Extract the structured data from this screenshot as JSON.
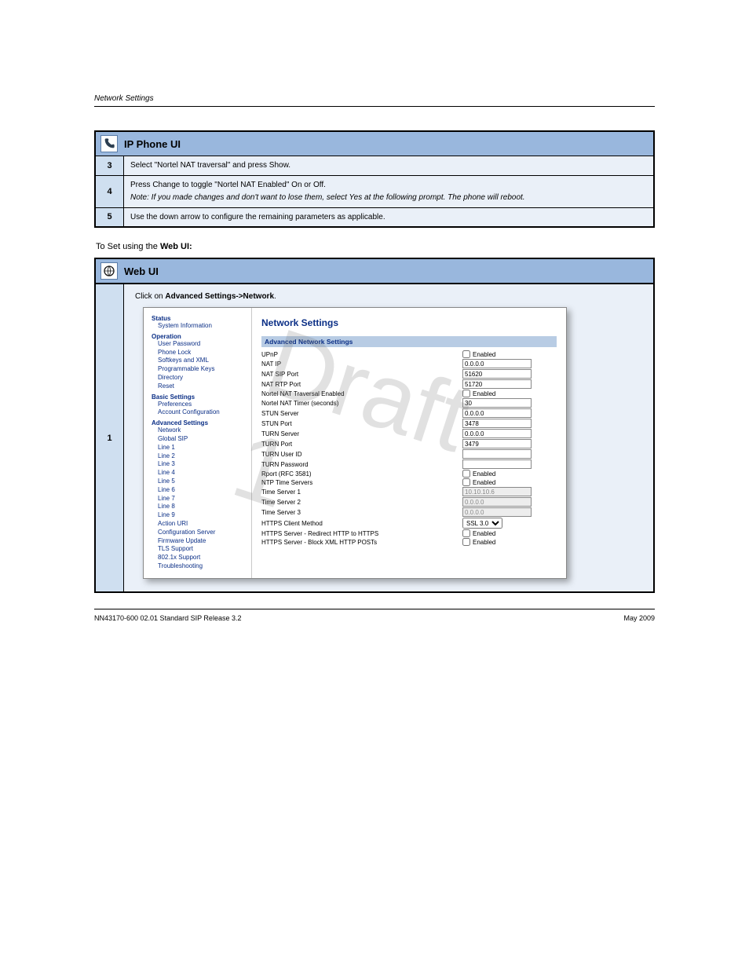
{
  "header": {
    "title": "Network Settings"
  },
  "phone_panel": {
    "title": "IP Phone UI",
    "steps": [
      {
        "num": "3",
        "text": "Select \"Nortel NAT traversal\" and press Show."
      },
      {
        "num": "4",
        "text": "Press Change to toggle \"Nortel NAT Enabled\" On or Off.",
        "note": "Note: If you made changes and don't want to lose them, select Yes at the following prompt. The phone will reboot."
      },
      {
        "num": "5",
        "text": "Use the down arrow to configure the remaining parameters as applicable."
      }
    ]
  },
  "section_label": {
    "prefix": "To Set using the ",
    "strong": "Web UI:"
  },
  "web_panel": {
    "title": "Web UI",
    "step1": {
      "num": "1",
      "text_prefix": "Click on ",
      "link": "Advanced Settings->Network",
      "text_suffix": "."
    }
  },
  "screenshot": {
    "sidebar": {
      "groups": [
        {
          "header": "Status",
          "items": [
            "System Information"
          ]
        },
        {
          "header": "Operation",
          "items": [
            "User Password",
            "Phone Lock",
            "Softkeys and XML",
            "Programmable Keys",
            "Directory",
            "Reset"
          ]
        },
        {
          "header": "Basic Settings",
          "items": [
            "Preferences",
            "Account Configuration"
          ]
        },
        {
          "header": "Advanced Settings",
          "items": [
            "Network",
            "Global SIP",
            "Line 1",
            "Line 2",
            "Line 3",
            "Line 4",
            "Line 5",
            "Line 6",
            "Line 7",
            "Line 8",
            "Line 9",
            "Action URI",
            "Configuration Server",
            "Firmware Update",
            "TLS Support",
            "802.1x Support",
            "Troubleshooting"
          ]
        }
      ]
    },
    "main": {
      "page_title": "Network Settings",
      "section_title": "Advanced Network Settings",
      "rows": [
        {
          "label": "UPnP",
          "type": "check",
          "text": "Enabled",
          "checked": false
        },
        {
          "label": "NAT IP",
          "type": "text",
          "value": "0.0.0.0"
        },
        {
          "label": "NAT SIP Port",
          "type": "text",
          "value": "51620"
        },
        {
          "label": "NAT RTP Port",
          "type": "text",
          "value": "51720"
        },
        {
          "label": "Nortel NAT Traversal Enabled",
          "type": "check",
          "text": "Enabled",
          "checked": false
        },
        {
          "label": "Nortel NAT Timer (seconds)",
          "type": "text",
          "value": "30"
        },
        {
          "label": "STUN Server",
          "type": "text",
          "value": "0.0.0.0"
        },
        {
          "label": "STUN Port",
          "type": "text",
          "value": "3478"
        },
        {
          "label": "TURN Server",
          "type": "text",
          "value": "0.0.0.0"
        },
        {
          "label": "TURN Port",
          "type": "text",
          "value": "3479"
        },
        {
          "label": "TURN User ID",
          "type": "text",
          "value": ""
        },
        {
          "label": "TURN Password",
          "type": "text",
          "value": ""
        },
        {
          "label": "Rport (RFC 3581)",
          "type": "check",
          "text": "Enabled",
          "checked": false
        },
        {
          "label": "NTP Time Servers",
          "type": "check",
          "text": "Enabled",
          "checked": false
        },
        {
          "label": "Time Server 1",
          "type": "text",
          "value": "10.10.10.6",
          "disabled": true
        },
        {
          "label": "Time Server 2",
          "type": "text",
          "value": "0.0.0.0",
          "disabled": true
        },
        {
          "label": "Time Server 3",
          "type": "text",
          "value": "0.0.0.0",
          "disabled": true
        },
        {
          "label": "HTTPS Client Method",
          "type": "select",
          "value": "SSL 3.0"
        },
        {
          "label": "HTTPS Server - Redirect HTTP to HTTPS",
          "type": "check",
          "text": "Enabled",
          "checked": false
        },
        {
          "label": "HTTPS Server - Block XML HTTP POSTs",
          "type": "check",
          "text": "Enabled",
          "checked": false
        }
      ]
    }
  },
  "watermark": "Draft 1",
  "footer": {
    "left": "NN43170-600 02.01 Standard SIP Release 3.2",
    "right": "May 2009"
  }
}
